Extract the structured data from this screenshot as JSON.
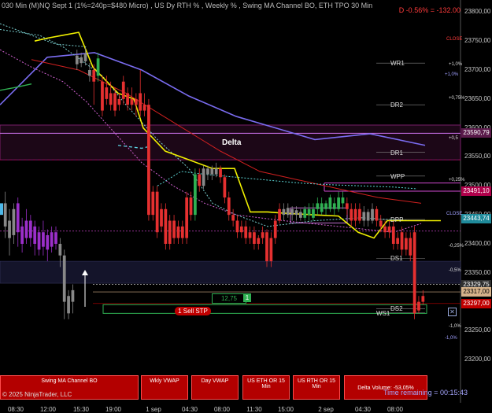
{
  "header": {
    "title": "030 Min (M)NQ Sept 1  (1%=240p=$480 Micro) , US Dy RTH % , Weekly % , Swing MA Channel BO, ETH TPO 30 Min",
    "pnl": "D -0.56% = -132.00"
  },
  "chart_data": {
    "type": "candlestick",
    "y_ticks": [
      "23800,00",
      "23750,00",
      "23700,00",
      "23650,00",
      "23600,00",
      "23550,00",
      "23500,00",
      "23450,00",
      "23400,00",
      "23350,00",
      "23300,00",
      "23250,00",
      "23200,00"
    ],
    "x_ticks": [
      "08:30",
      "12:00",
      "15:30",
      "19:00",
      "1 sep",
      "04:30",
      "08:00",
      "11:30",
      "15:00",
      "2 sep",
      "04:30",
      "08:00"
    ],
    "ylim": [
      23180,
      23810
    ],
    "price_tags": [
      {
        "label": "23590,79",
        "value": 23590.79,
        "color": "#5a1a4a"
      },
      {
        "label": "23491,10",
        "value": 23491.1,
        "color": "#b0004a"
      },
      {
        "label": "23443,74",
        "value": 23443.74,
        "color": "#1f8a9a"
      },
      {
        "label": "23329,75",
        "value": 23329.75,
        "color": "#303030"
      },
      {
        "label": "23317,00",
        "value": 23317.0,
        "color": "#d6b28a"
      },
      {
        "label": "23297,00",
        "value": 23297.0,
        "color": "#c00000"
      }
    ],
    "levels": [
      {
        "label": "WR1",
        "value": 23712
      },
      {
        "label": "DR2",
        "value": 23640
      },
      {
        "label": "DR1",
        "value": 23558
      },
      {
        "label": "WPP",
        "value": 23517
      },
      {
        "label": "DPP",
        "value": 23442
      },
      {
        "label": "DS1",
        "value": 23375
      },
      {
        "label": "DS2",
        "value": 23288
      },
      {
        "label": "WS1",
        "value": 23281
      }
    ],
    "pct_labels": [
      {
        "label": "CLOSE",
        "value": 23752,
        "color": "#ff3b3b"
      },
      {
        "label": "+1,0%",
        "value": 23708,
        "color": "#ddd"
      },
      {
        "label": "+1,0%",
        "value": 23690,
        "color": "#a0a0ff"
      },
      {
        "label": "+0,75%",
        "value": 23650,
        "color": "#ddd"
      },
      {
        "label": "+0,5",
        "value": 23580,
        "color": "#ddd"
      },
      {
        "label": "+0,25%",
        "value": 23509,
        "color": "#ddd"
      },
      {
        "label": "CLOSE",
        "value": 23450,
        "color": "#a0a0ff"
      },
      {
        "label": "-0,25%",
        "value": 23394,
        "color": "#ddd"
      },
      {
        "label": "-0,5%",
        "value": 23352,
        "color": "#ddd"
      },
      {
        "label": "-1,0%",
        "value": 23256,
        "color": "#ddd"
      },
      {
        "label": "-1,0%",
        "value": 23236,
        "color": "#a0a0ff"
      }
    ],
    "annotations": {
      "delta_label": "Delta",
      "position_qty": "12,75",
      "position_side": "1",
      "order_label": "1  Sell STP"
    },
    "candles": [
      {
        "o": 23430,
        "c": 23470,
        "h": 23490,
        "l": 23410,
        "col": "#888"
      },
      {
        "o": 23440,
        "c": 23410,
        "h": 23460,
        "l": 23380,
        "col": "#888"
      },
      {
        "o": 23415,
        "c": 23460,
        "h": 23470,
        "l": 23400,
        "col": "#888"
      },
      {
        "o": 23470,
        "c": 23420,
        "h": 23480,
        "l": 23395,
        "col": "#9b2fc9"
      },
      {
        "o": 23430,
        "c": 23400,
        "h": 23445,
        "l": 23385,
        "col": "#9b2fc9"
      },
      {
        "o": 23410,
        "c": 23440,
        "h": 23460,
        "l": 23400,
        "col": "#9b2fc9"
      },
      {
        "o": 23440,
        "c": 23410,
        "h": 23450,
        "l": 23395,
        "col": "#9b2fc9"
      },
      {
        "o": 23400,
        "c": 23430,
        "h": 23440,
        "l": 23380,
        "col": "#9b2fc9"
      },
      {
        "o": 23420,
        "c": 23390,
        "h": 23430,
        "l": 23380,
        "col": "#9b2fc9"
      },
      {
        "o": 23395,
        "c": 23420,
        "h": 23440,
        "l": 23380,
        "col": "#9b2fc9"
      },
      {
        "o": 23415,
        "c": 23390,
        "h": 23425,
        "l": 23370,
        "col": "#9b2fc9"
      },
      {
        "o": 23395,
        "c": 23420,
        "h": 23430,
        "l": 23385,
        "col": "#9b2fc9"
      },
      {
        "o": 23420,
        "c": 23400,
        "h": 23430,
        "l": 23390,
        "col": "#9b2fc9"
      },
      {
        "o": 23400,
        "c": 23380,
        "h": 23410,
        "l": 23360,
        "col": "#888"
      },
      {
        "o": 23380,
        "c": 23300,
        "h": 23390,
        "l": 23270,
        "col": "#888"
      },
      {
        "o": 23310,
        "c": 23280,
        "h": 23320,
        "l": 23270,
        "col": "#888"
      },
      {
        "o": 23300,
        "c": 23320,
        "h": 23330,
        "l": 23280,
        "col": "#888"
      },
      {
        "o": 23710,
        "c": 23725,
        "h": 23735,
        "l": 23700,
        "col": "#888"
      },
      {
        "o": 23722,
        "c": 23712,
        "h": 23730,
        "l": 23705,
        "col": "#888"
      },
      {
        "o": 23715,
        "c": 23728,
        "h": 23740,
        "l": 23708,
        "col": "#888"
      },
      {
        "o": 23700,
        "c": 23690,
        "h": 23712,
        "l": 23680,
        "col": "#888"
      },
      {
        "o": 23700,
        "c": 23680,
        "h": 23710,
        "l": 23640,
        "col": "#e53030"
      },
      {
        "o": 23690,
        "c": 23720,
        "h": 23730,
        "l": 23680,
        "col": "#2fb052"
      },
      {
        "o": 23680,
        "c": 23630,
        "h": 23690,
        "l": 23620,
        "col": "#e53030"
      },
      {
        "o": 23650,
        "c": 23670,
        "h": 23690,
        "l": 23640,
        "col": "#e53030"
      },
      {
        "o": 23640,
        "c": 23660,
        "h": 23680,
        "l": 23630,
        "col": "#e53030"
      },
      {
        "o": 23630,
        "c": 23660,
        "h": 23670,
        "l": 23620,
        "col": "#e53030"
      },
      {
        "o": 23650,
        "c": 23640,
        "h": 23660,
        "l": 23630,
        "col": "#e53030"
      },
      {
        "o": 23650,
        "c": 23680,
        "h": 23690,
        "l": 23640,
        "col": "#e53030"
      },
      {
        "o": 23660,
        "c": 23640,
        "h": 23670,
        "l": 23630,
        "col": "#e53030"
      },
      {
        "o": 23640,
        "c": 23650,
        "h": 23670,
        "l": 23630,
        "col": "#e53030"
      },
      {
        "o": 23650,
        "c": 23640,
        "h": 23660,
        "l": 23620,
        "col": "#e53030"
      },
      {
        "o": 23660,
        "c": 23630,
        "h": 23700,
        "l": 23620,
        "col": "#e53030"
      },
      {
        "o": 23630,
        "c": 23640,
        "h": 23660,
        "l": 23620,
        "col": "#e53030"
      },
      {
        "o": 23640,
        "c": 23450,
        "h": 23650,
        "l": 23440,
        "col": "#e53030"
      },
      {
        "o": 23450,
        "c": 23490,
        "h": 23500,
        "l": 23440,
        "col": "#e53030"
      },
      {
        "o": 23490,
        "c": 23420,
        "h": 23500,
        "l": 23410,
        "col": "#e53030"
      },
      {
        "o": 23430,
        "c": 23460,
        "h": 23470,
        "l": 23420,
        "col": "#e53030"
      },
      {
        "o": 23460,
        "c": 23400,
        "h": 23470,
        "l": 23390,
        "col": "#e53030"
      },
      {
        "o": 23400,
        "c": 23440,
        "h": 23450,
        "l": 23390,
        "col": "#e53030"
      },
      {
        "o": 23440,
        "c": 23410,
        "h": 23450,
        "l": 23400,
        "col": "#e53030"
      },
      {
        "o": 23410,
        "c": 23430,
        "h": 23440,
        "l": 23400,
        "col": "#e53030"
      },
      {
        "o": 23430,
        "c": 23410,
        "h": 23440,
        "l": 23400,
        "col": "#e53030"
      },
      {
        "o": 23410,
        "c": 23480,
        "h": 23490,
        "l": 23400,
        "col": "#e53030"
      },
      {
        "o": 23480,
        "c": 23450,
        "h": 23490,
        "l": 23440,
        "col": "#e53030"
      },
      {
        "o": 23450,
        "c": 23520,
        "h": 23530,
        "l": 23440,
        "col": "#2fb052"
      },
      {
        "o": 23520,
        "c": 23500,
        "h": 23530,
        "l": 23490,
        "col": "#e53030"
      },
      {
        "o": 23500,
        "c": 23530,
        "h": 23535,
        "l": 23495,
        "col": "#888"
      },
      {
        "o": 23520,
        "c": 23530,
        "h": 23535,
        "l": 23510,
        "col": "#888"
      },
      {
        "o": 23530,
        "c": 23520,
        "h": 23535,
        "l": 23510,
        "col": "#888"
      },
      {
        "o": 23520,
        "c": 23530,
        "h": 23540,
        "l": 23515,
        "col": "#888"
      },
      {
        "o": 23530,
        "c": 23515,
        "h": 23535,
        "l": 23505,
        "col": "#e53030"
      },
      {
        "o": 23515,
        "c": 23480,
        "h": 23520,
        "l": 23470,
        "col": "#e53030"
      },
      {
        "o": 23480,
        "c": 23450,
        "h": 23490,
        "l": 23440,
        "col": "#e53030"
      },
      {
        "o": 23450,
        "c": 23440,
        "h": 23460,
        "l": 23430,
        "col": "#e53030"
      },
      {
        "o": 23440,
        "c": 23420,
        "h": 23450,
        "l": 23410,
        "col": "#e53030"
      },
      {
        "o": 23420,
        "c": 23430,
        "h": 23440,
        "l": 23410,
        "col": "#e53030"
      },
      {
        "o": 23430,
        "c": 23410,
        "h": 23440,
        "l": 23400,
        "col": "#e53030"
      },
      {
        "o": 23410,
        "c": 23420,
        "h": 23430,
        "l": 23400,
        "col": "#e53030"
      },
      {
        "o": 23420,
        "c": 23400,
        "h": 23430,
        "l": 23390,
        "col": "#e53030"
      },
      {
        "o": 23400,
        "c": 23410,
        "h": 23415,
        "l": 23390,
        "col": "#e53030"
      },
      {
        "o": 23410,
        "c": 23420,
        "h": 23430,
        "l": 23400,
        "col": "#e53030"
      },
      {
        "o": 23420,
        "c": 23370,
        "h": 23425,
        "l": 23360,
        "col": "#e53030"
      },
      {
        "o": 23370,
        "c": 23410,
        "h": 23420,
        "l": 23360,
        "col": "#e53030"
      },
      {
        "o": 23410,
        "c": 23440,
        "h": 23450,
        "l": 23400,
        "col": "#e53030"
      },
      {
        "o": 23440,
        "c": 23460,
        "h": 23470,
        "l": 23435,
        "col": "#e53030"
      },
      {
        "o": 23460,
        "c": 23450,
        "h": 23470,
        "l": 23440,
        "col": "#888"
      },
      {
        "o": 23450,
        "c": 23462,
        "h": 23470,
        "l": 23445,
        "col": "#888"
      },
      {
        "o": 23460,
        "c": 23450,
        "h": 23465,
        "l": 23440,
        "col": "#888"
      },
      {
        "o": 23450,
        "c": 23458,
        "h": 23465,
        "l": 23440,
        "col": "#888"
      },
      {
        "o": 23455,
        "c": 23445,
        "h": 23460,
        "l": 23440,
        "col": "#888"
      },
      {
        "o": 23445,
        "c": 23460,
        "h": 23465,
        "l": 23440,
        "col": "#2fb052"
      },
      {
        "o": 23460,
        "c": 23450,
        "h": 23470,
        "l": 23440,
        "col": "#2fb052"
      },
      {
        "o": 23445,
        "c": 23460,
        "h": 23470,
        "l": 23440,
        "col": "#2fb052"
      },
      {
        "o": 23460,
        "c": 23470,
        "h": 23480,
        "l": 23450,
        "col": "#2fb052"
      },
      {
        "o": 23455,
        "c": 23470,
        "h": 23480,
        "l": 23450,
        "col": "#2fb052"
      },
      {
        "o": 23470,
        "c": 23460,
        "h": 23475,
        "l": 23450,
        "col": "#2fb052"
      },
      {
        "o": 23460,
        "c": 23480,
        "h": 23485,
        "l": 23455,
        "col": "#2fb052"
      },
      {
        "o": 23470,
        "c": 23460,
        "h": 23480,
        "l": 23450,
        "col": "#2fb052"
      },
      {
        "o": 23460,
        "c": 23480,
        "h": 23490,
        "l": 23455,
        "col": "#2fb052"
      },
      {
        "o": 23480,
        "c": 23470,
        "h": 23490,
        "l": 23460,
        "col": "#2fb052"
      },
      {
        "o": 23470,
        "c": 23460,
        "h": 23480,
        "l": 23450,
        "col": "#e53030"
      },
      {
        "o": 23460,
        "c": 23440,
        "h": 23470,
        "l": 23430,
        "col": "#e53030"
      },
      {
        "o": 23440,
        "c": 23460,
        "h": 23470,
        "l": 23430,
        "col": "#e53030"
      },
      {
        "o": 23460,
        "c": 23440,
        "h": 23470,
        "l": 23435,
        "col": "#e53030"
      },
      {
        "o": 23440,
        "c": 23455,
        "h": 23465,
        "l": 23430,
        "col": "#888"
      },
      {
        "o": 23455,
        "c": 23440,
        "h": 23460,
        "l": 23430,
        "col": "#888"
      },
      {
        "o": 23440,
        "c": 23460,
        "h": 23470,
        "l": 23435,
        "col": "#888"
      },
      {
        "o": 23460,
        "c": 23440,
        "h": 23465,
        "l": 23430,
        "col": "#e53030"
      },
      {
        "o": 23440,
        "c": 23430,
        "h": 23450,
        "l": 23420,
        "col": "#e53030"
      },
      {
        "o": 23430,
        "c": 23420,
        "h": 23440,
        "l": 23410,
        "col": "#e53030"
      },
      {
        "o": 23420,
        "c": 23430,
        "h": 23440,
        "l": 23410,
        "col": "#e53030"
      },
      {
        "o": 23430,
        "c": 23400,
        "h": 23440,
        "l": 23390,
        "col": "#e53030"
      },
      {
        "o": 23400,
        "c": 23410,
        "h": 23420,
        "l": 23390,
        "col": "#e53030"
      },
      {
        "o": 23420,
        "c": 23390,
        "h": 23430,
        "l": 23380,
        "col": "#e53030"
      },
      {
        "o": 23390,
        "c": 23410,
        "h": 23420,
        "l": 23380,
        "col": "#e53030"
      },
      {
        "o": 23410,
        "c": 23380,
        "h": 23420,
        "l": 23370,
        "col": "#e53030"
      },
      {
        "o": 23420,
        "c": 23280,
        "h": 23430,
        "l": 23270,
        "col": "#e53030"
      },
      {
        "o": 23285,
        "c": 23300,
        "h": 23310,
        "l": 23280,
        "col": "#e53030"
      },
      {
        "o": 23300,
        "c": 23310,
        "h": 23320,
        "l": 23295,
        "col": "#e53030"
      }
    ]
  },
  "tiles": [
    {
      "name": "swing-ma-channel-bo-tile",
      "label": "Swing MA Channel BO"
    },
    {
      "name": "wkly-vwap-tile",
      "label": "Wkly VWAP"
    },
    {
      "name": "day-vwap-tile",
      "label": "Day VWAP"
    },
    {
      "name": "us-eth-or-tile",
      "label": "US ETH OR 15 Min"
    },
    {
      "name": "us-rth-or-tile",
      "label": "US RTH OR 15 Min"
    },
    {
      "name": "delta-volume-tile",
      "label": "Delta Volume: -53,05%"
    }
  ],
  "footer": {
    "copyright": "© 2025 NinjaTrader, LLC",
    "time_remaining": "Time remaining = 00:15:43"
  }
}
